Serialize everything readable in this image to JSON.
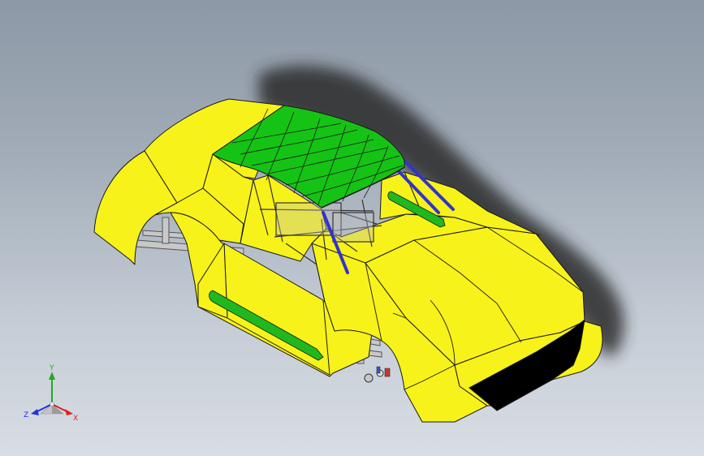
{
  "viewport": {
    "background_top": "#8d98a6",
    "background_bottom": "#d8dde3"
  },
  "model": {
    "body_color": "#f7f21a",
    "roof_color": "#15c315",
    "stripe_color": "#1fb81f",
    "roll_bar_color": "#3333cc",
    "grille_color": "#000000",
    "frame_color": "#c8c8c8",
    "edge_color": "#1a1a1a"
  },
  "triad": {
    "y_label": "Y",
    "x_label": "X",
    "z_label": "Z",
    "y_color": "#22aa22",
    "x_color": "#dd2222",
    "z_color": "#2233dd"
  }
}
